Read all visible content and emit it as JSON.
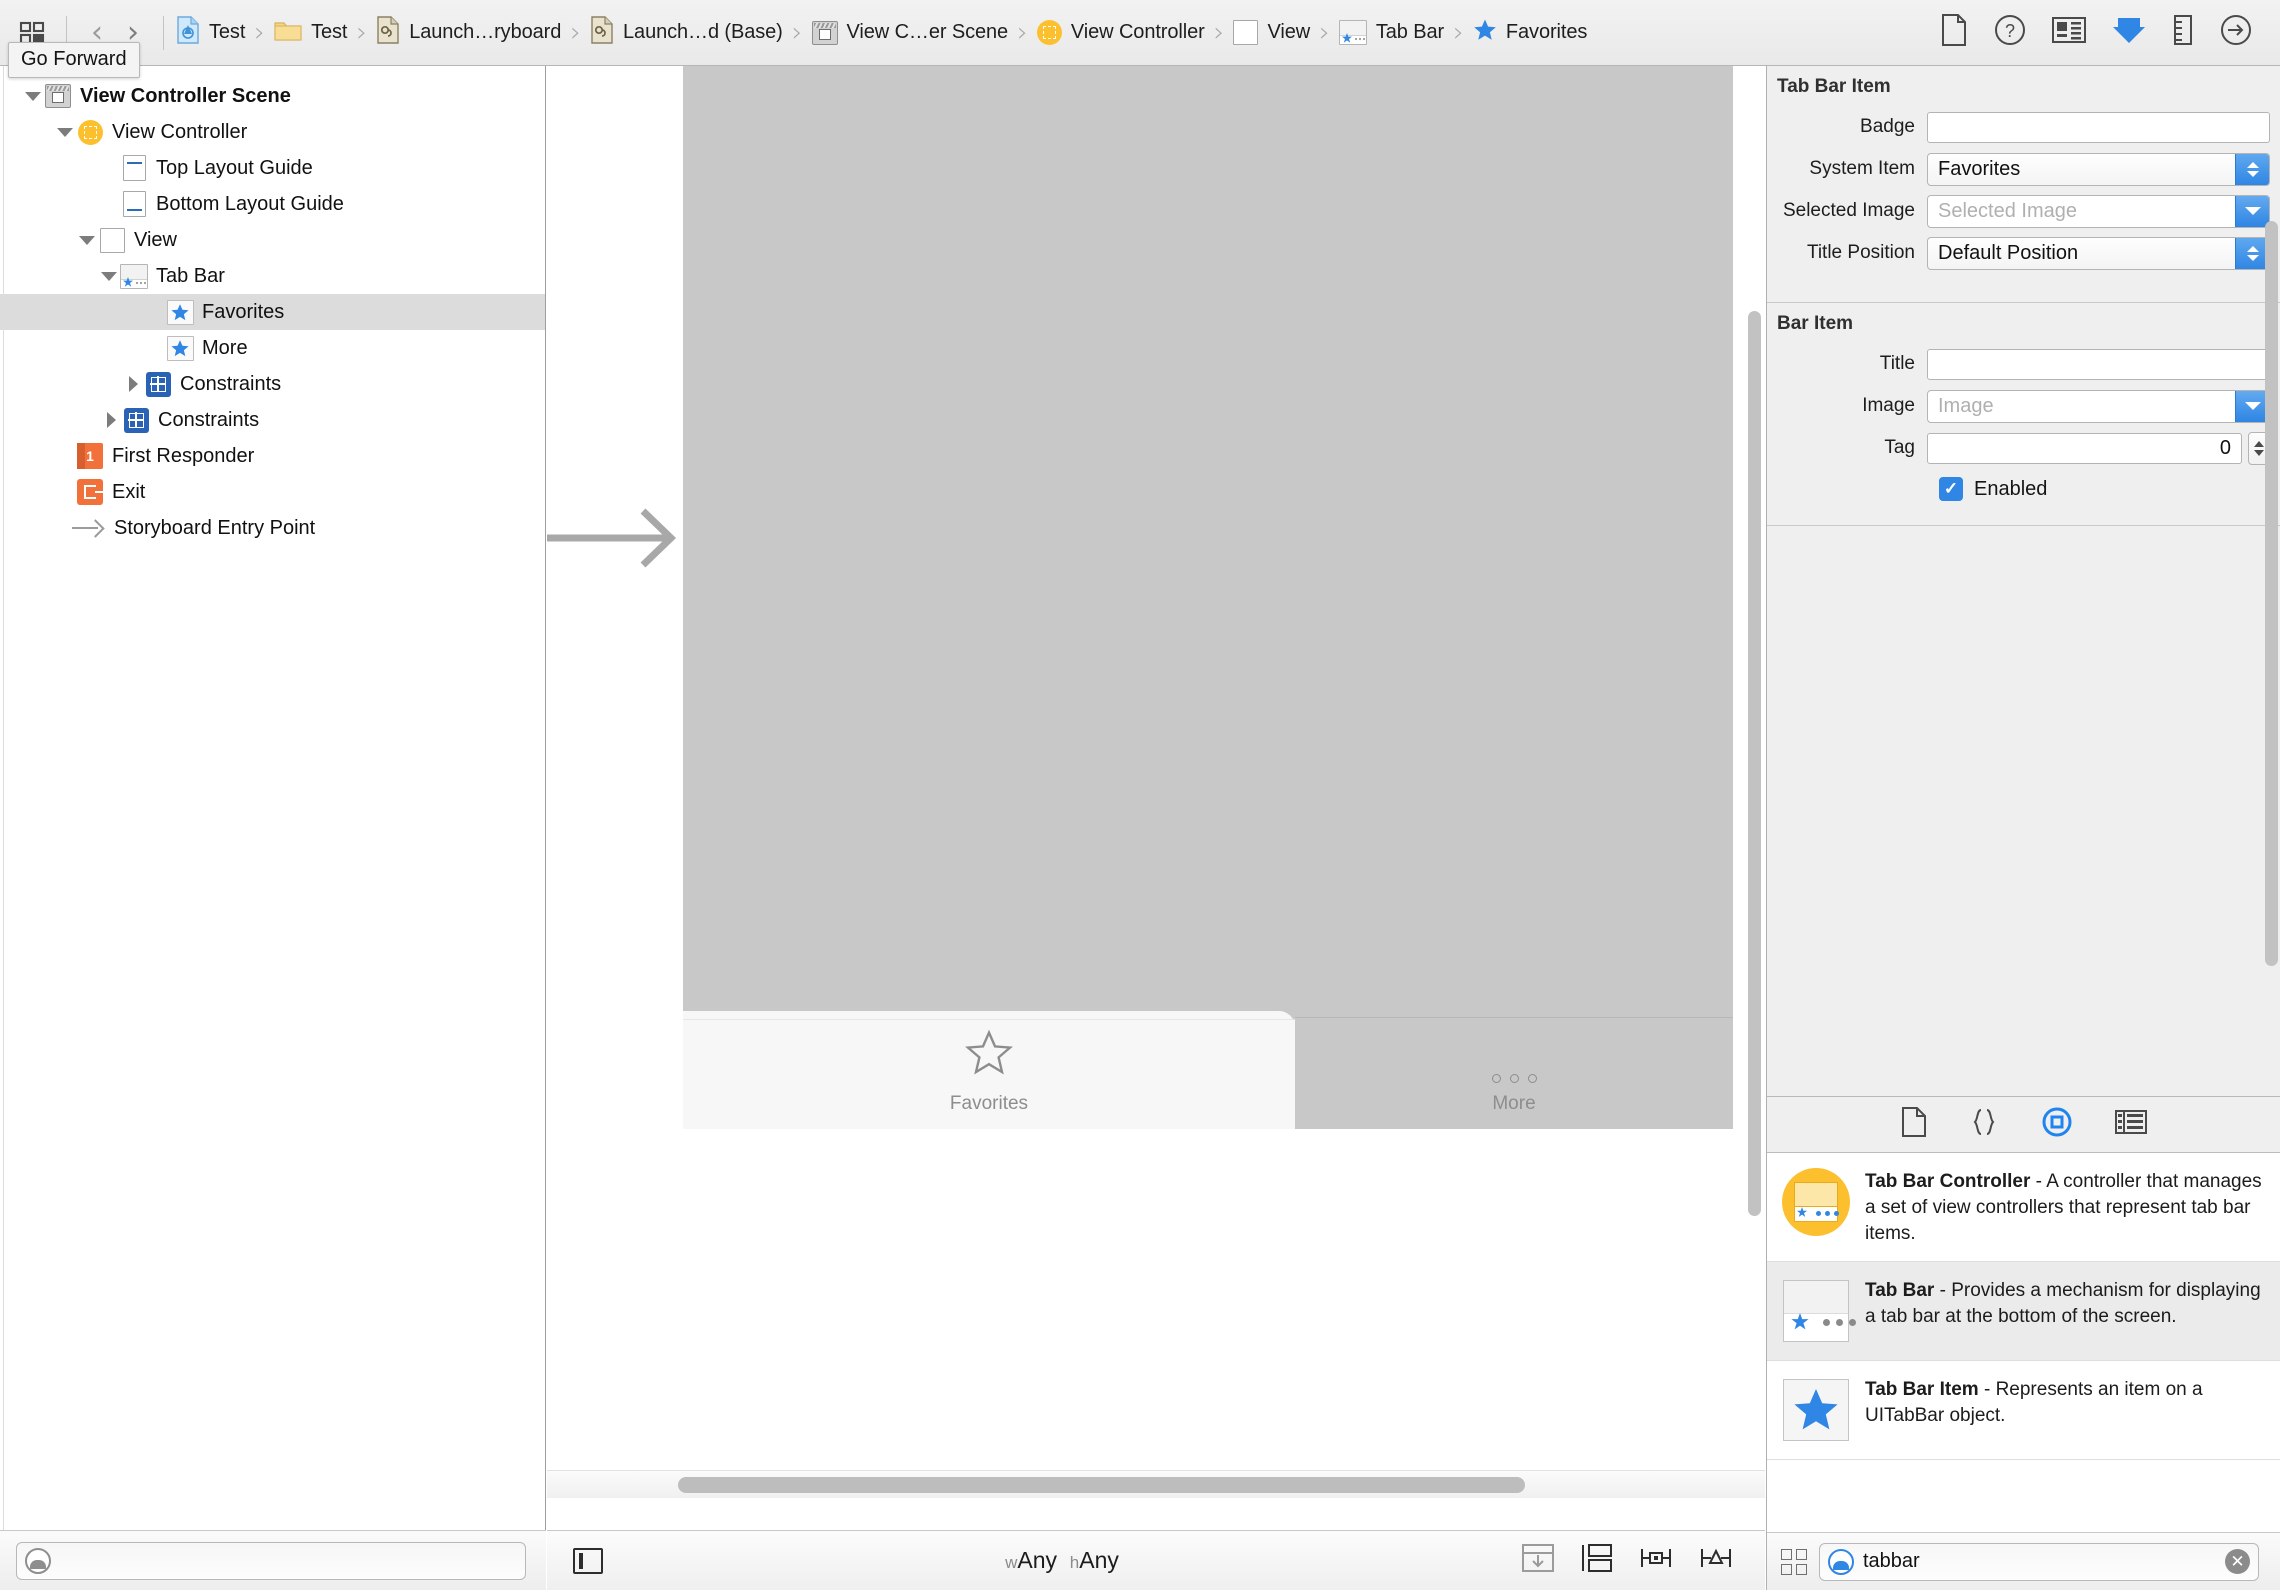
{
  "toolbar": {
    "navigator_toggle": "navigator-toggle-icon",
    "back_label": "Go Back",
    "forward_label": "Go Forward",
    "tooltip": "Go Forward",
    "right_icons": [
      {
        "name": "file-inspector-icon",
        "label": "File Inspector"
      },
      {
        "name": "quick-help-icon",
        "label": "Quick Help"
      },
      {
        "name": "identity-inspector-icon",
        "label": "Identity Inspector"
      },
      {
        "name": "attributes-inspector-icon",
        "label": "Attributes Inspector"
      },
      {
        "name": "size-inspector-icon",
        "label": "Size Inspector"
      },
      {
        "name": "connections-inspector-icon",
        "label": "Connections Inspector"
      }
    ]
  },
  "breadcrumb": [
    {
      "label": "Test",
      "icon": "project-icon"
    },
    {
      "label": "Test",
      "icon": "folder-icon"
    },
    {
      "label": "Launch…ryboard",
      "icon": "storyboard-icon"
    },
    {
      "label": "Launch…d (Base)",
      "icon": "storyboard-icon"
    },
    {
      "label": "View C…er Scene",
      "icon": "scene-icon"
    },
    {
      "label": "View Controller",
      "icon": "view-controller-icon"
    },
    {
      "label": "View",
      "icon": "view-icon"
    },
    {
      "label": "Tab Bar",
      "icon": "tab-bar-icon"
    },
    {
      "label": "Favorites",
      "icon": "star-icon"
    }
  ],
  "outline": {
    "rows": [
      {
        "label": "View Controller Scene",
        "indent": 0,
        "twisty": "down",
        "icon": "scene-icon",
        "bold": true,
        "selected": false
      },
      {
        "label": "View Controller",
        "indent": 1,
        "twisty": "down",
        "icon": "view-controller-icon",
        "bold": false,
        "selected": false
      },
      {
        "label": "Top Layout Guide",
        "indent": 2,
        "twisty": "none",
        "icon": "top-layout-guide-icon",
        "bold": false,
        "selected": false
      },
      {
        "label": "Bottom Layout Guide",
        "indent": 2,
        "twisty": "none",
        "icon": "bottom-layout-guide-icon",
        "bold": false,
        "selected": false
      },
      {
        "label": "View",
        "indent": 2,
        "twisty": "down",
        "icon": "view-icon",
        "bold": false,
        "selected": false
      },
      {
        "label": "Tab Bar",
        "indent": 3,
        "twisty": "down",
        "icon": "tab-bar-icon",
        "bold": false,
        "selected": false
      },
      {
        "label": "Favorites",
        "indent": 4,
        "twisty": "none",
        "icon": "star-icon",
        "bold": false,
        "selected": true
      },
      {
        "label": "More",
        "indent": 4,
        "twisty": "none",
        "icon": "star-icon",
        "bold": false,
        "selected": false
      },
      {
        "label": "Constraints",
        "indent": 4,
        "twisty": "right",
        "icon": "constraints-icon",
        "bold": false,
        "selected": false
      },
      {
        "label": "Constraints",
        "indent": 3,
        "twisty": "right",
        "icon": "constraints-icon",
        "bold": false,
        "selected": false
      },
      {
        "label": "First Responder",
        "indent": 2,
        "twisty": "none",
        "icon": "first-responder-icon",
        "bold": false,
        "selected": false
      },
      {
        "label": "Exit",
        "indent": 2,
        "twisty": "none",
        "icon": "exit-icon",
        "bold": false,
        "selected": false
      },
      {
        "label": "Storyboard Entry Point",
        "indent": 2,
        "twisty": "none",
        "icon": "entry-point-icon",
        "bold": false,
        "selected": false
      }
    ],
    "filter_placeholder": ""
  },
  "canvas": {
    "tabs": [
      {
        "label": "Favorites",
        "icon": "star-outline-icon",
        "selected": true
      },
      {
        "label": "More",
        "icon": "three-dots-icon",
        "selected": false
      }
    ],
    "bottom": {
      "size_class_w_prefix": "w",
      "size_class_w": "Any",
      "size_class_h_prefix": "h",
      "size_class_h": "Any",
      "tools": [
        {
          "name": "update-frames-icon"
        },
        {
          "name": "embed-in-icon"
        },
        {
          "name": "align-icon"
        },
        {
          "name": "pin-icon"
        }
      ]
    }
  },
  "inspector": {
    "sections": [
      {
        "title": "Tab Bar Item",
        "fields": [
          {
            "type": "text",
            "label": "Badge",
            "value": "",
            "placeholder": ""
          },
          {
            "type": "select",
            "label": "System Item",
            "value": "Favorites",
            "placeholder": "",
            "stepper": "updown"
          },
          {
            "type": "select",
            "label": "Selected Image",
            "value": "",
            "placeholder": "Selected Image",
            "stepper": "down"
          },
          {
            "type": "select",
            "label": "Title Position",
            "value": "Default Position",
            "placeholder": "",
            "stepper": "updown"
          }
        ]
      },
      {
        "title": "Bar Item",
        "fields": [
          {
            "type": "text",
            "label": "Title",
            "value": "",
            "placeholder": ""
          },
          {
            "type": "select",
            "label": "Image",
            "value": "",
            "placeholder": "Image",
            "stepper": "down"
          },
          {
            "type": "number",
            "label": "Tag",
            "value": "0",
            "placeholder": ""
          },
          {
            "type": "checkbox",
            "label": "Enabled",
            "checked": true
          }
        ]
      }
    ]
  },
  "library": {
    "tabs": [
      {
        "name": "file-template-library-icon",
        "active": false
      },
      {
        "name": "code-snippet-library-icon",
        "active": false
      },
      {
        "name": "object-library-icon",
        "active": true
      },
      {
        "name": "media-library-icon",
        "active": false
      }
    ],
    "items": [
      {
        "icon": "tab-bar-controller-icon",
        "title": "Tab Bar Controller",
        "description": " - A controller that manages a set of view controllers that represent tab bar items."
      },
      {
        "icon": "tab-bar-icon",
        "title": "Tab Bar",
        "description": " - Provides a mechanism for displaying a tab bar at the bottom of the screen."
      },
      {
        "icon": "tab-bar-item-icon",
        "title": "Tab Bar Item",
        "description": " - Represents an item on a UITabBar object."
      }
    ],
    "search_value": "tabbar",
    "search_placeholder": ""
  },
  "colors": {
    "accent_blue": "#2f86e4",
    "star_blue": "#2f86e4",
    "yellow": "#fcc02e",
    "orange": "#f2703a",
    "selection_grey": "#dcdcdc"
  }
}
